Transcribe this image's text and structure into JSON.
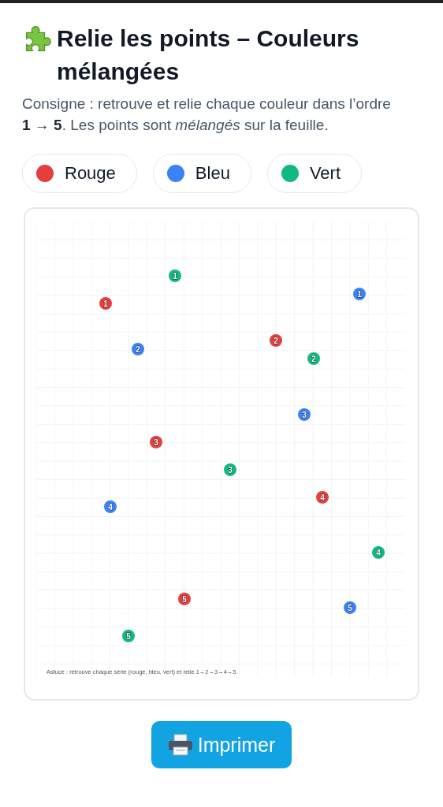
{
  "title": "Relie les points – Couleurs mélangées",
  "instructions": "Consigne : retrouve et relie chaque couleur dans l’ordre **1 → 5**. Les points sont *mélangés* sur la feuille.",
  "legend": [
    {
      "label": "Rouge",
      "color": "#e53e3e"
    },
    {
      "label": "Bleu",
      "color": "#3b82f6"
    },
    {
      "label": "Vert",
      "color": "#10b981"
    }
  ],
  "sheet": {
    "series": [
      {
        "color": "#e53e3e",
        "points": [
          "1",
          "2",
          "3",
          "4",
          "5"
        ]
      },
      {
        "color": "#3b82f6",
        "points": [
          "1",
          "2",
          "3",
          "4",
          "5"
        ]
      },
      {
        "color": "#10b981",
        "points": [
          "1",
          "2",
          "3",
          "4",
          "5"
        ]
      }
    ],
    "hint": "Astuce : retrouve chaque série (rouge, bleu, vert) et relie 1→2→3→4→5."
  },
  "print_button": "Imprimer"
}
